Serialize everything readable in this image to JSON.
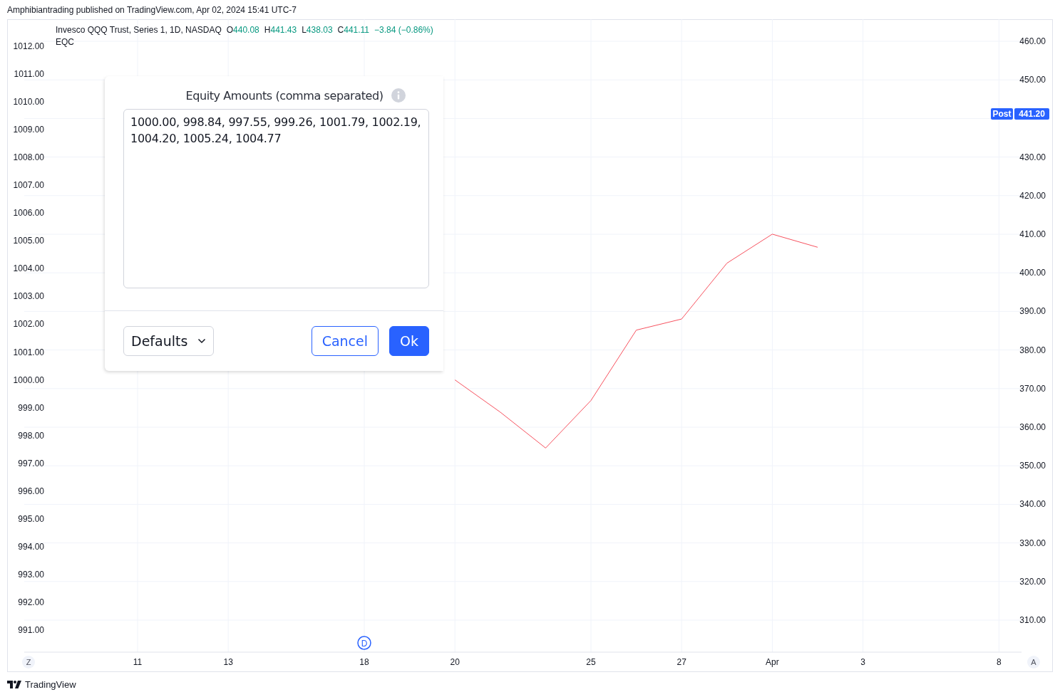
{
  "caption": "Amphibiantrading published on TradingView.com, Apr 02, 2024 15:41 UTC-7",
  "legend": {
    "symbol": "Invesco QQQ Trust, Series 1, 1D, NASDAQ",
    "ohlc": [
      {
        "key": "O",
        "value": "440.08"
      },
      {
        "key": "H",
        "value": "441.43"
      },
      {
        "key": "L",
        "value": "438.03"
      },
      {
        "key": "C",
        "value": "441.11"
      }
    ],
    "change": "−3.84 (−0.86%)"
  },
  "chart": {
    "chart_data": {
      "type": "line",
      "grid": true,
      "categories": [
        null,
        null,
        "11",
        null,
        "13",
        null,
        null,
        "18",
        null,
        "20",
        null,
        null,
        "25",
        null,
        "27",
        null,
        "Apr",
        null,
        "3",
        null,
        null,
        "8"
      ],
      "series": [
        {
          "name": "EQC",
          "color": "#f7525f",
          "values": [
            null,
            null,
            null,
            null,
            null,
            null,
            null,
            null,
            null,
            1000.0,
            998.84,
            997.55,
            999.26,
            1001.79,
            1002.19,
            1004.2,
            1005.24,
            1004.77,
            null,
            null,
            null,
            null
          ]
        }
      ],
      "ylim": [
        990.21,
        1012.97
      ],
      "yticks": [
        {
          "value": 1012,
          "label": "1012.00"
        },
        {
          "value": 1011,
          "label": "1011.00"
        },
        {
          "value": 1010,
          "label": "1010.00"
        },
        {
          "value": 1009,
          "label": "1009.00"
        },
        {
          "value": 1008,
          "label": "1008.00"
        },
        {
          "value": 1007,
          "label": "1007.00"
        },
        {
          "value": 1006,
          "label": "1006.00"
        },
        {
          "value": 1005,
          "label": "1005.00"
        },
        {
          "value": 1004,
          "label": "1004.00"
        },
        {
          "value": 1003,
          "label": "1003.00"
        },
        {
          "value": 1002,
          "label": "1002.00"
        },
        {
          "value": 1001,
          "label": "1001.00"
        },
        {
          "value": 1000,
          "label": "1000.00"
        },
        {
          "value": 999,
          "label": "999.00"
        },
        {
          "value": 998,
          "label": "998.00"
        },
        {
          "value": 997,
          "label": "997.00"
        },
        {
          "value": 996,
          "label": "996.00"
        },
        {
          "value": 995,
          "label": "995.00"
        },
        {
          "value": 994,
          "label": "994.00"
        },
        {
          "value": 993,
          "label": "993.00"
        },
        {
          "value": 992,
          "label": "992.00"
        },
        {
          "value": 991,
          "label": "991.00"
        }
      ],
      "annotations": [
        {
          "text": "D"
        }
      ]
    },
    "right_axis_labels": [
      "460.00",
      "450.00",
      "430.00",
      "420.00",
      "410.00",
      "400.00",
      "390.00",
      "380.00",
      "370.00",
      "360.00",
      "350.00",
      "340.00",
      "330.00",
      "320.00",
      "310.00"
    ],
    "price_tag": {
      "session": "Post",
      "price": "441.20"
    },
    "scale_buttons": [
      "Z",
      "A"
    ]
  },
  "dialog": {
    "label": "Equity Amounts (comma separated)",
    "value": "1000.00, 998.84, 997.55, 999.26, 1001.79, 1002.19, 1004.20, 1005.24, 1004.77",
    "preset": "Defaults",
    "buttons": [
      {
        "label": "Cancel",
        "kind": "secondary"
      },
      {
        "label": "Ok",
        "kind": "primary"
      }
    ]
  },
  "brand": "TradingView"
}
